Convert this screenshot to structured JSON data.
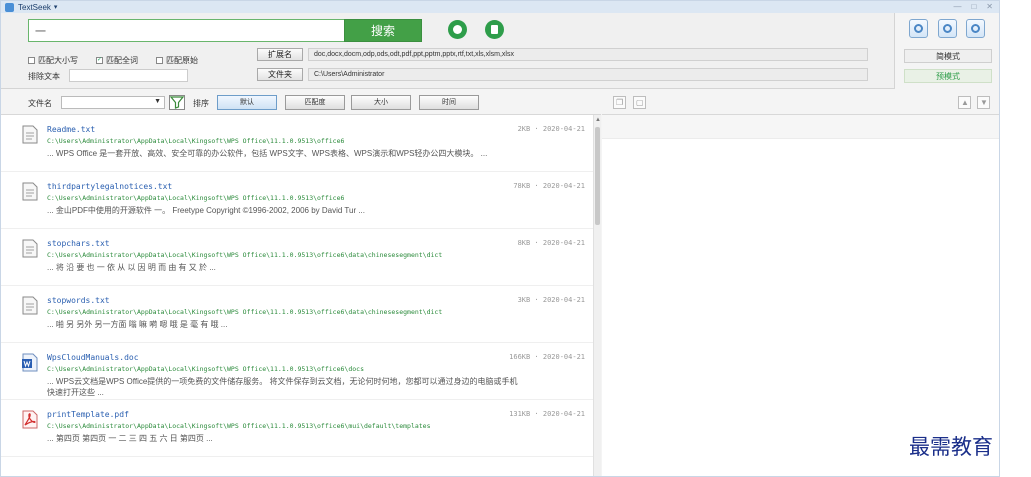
{
  "app": {
    "title": "TextSeek"
  },
  "search": {
    "query": "一",
    "button_label": "搜索"
  },
  "options": {
    "match_case": {
      "label": "匹配大小写",
      "checked": false
    },
    "match_whole": {
      "label": "匹配全词",
      "checked": true
    },
    "match_regex": {
      "label": "匹配原始",
      "checked": false
    },
    "exclude_label": "排除文本",
    "exclude_value": ""
  },
  "extension_row": {
    "button_label": "扩展名",
    "value": "doc,docx,docm,odp,ods,odt,pdf,ppt,pptm,pptx,rtf,txt,xls,xlsm,xlsx"
  },
  "folder_row": {
    "button_label": "文件夹",
    "value": "C:\\Users\\Administrator"
  },
  "side": {
    "mode_simple": "简模式",
    "mode_detail": "预模式"
  },
  "filter": {
    "filename_label": "文件名",
    "sort_label": "排序",
    "sort_buttons": [
      "默认",
      "匹配度",
      "大小",
      "时间"
    ]
  },
  "results": [
    {
      "name": "Readme.txt",
      "meta": "2KB · 2020-04-21",
      "path": "C:\\Users\\Administrator\\AppData\\Local\\Kingsoft\\WPS Office\\11.1.0.9513\\office6",
      "snippet": "... WPS Office 是一套开放、高效、安全可靠的办公软件，包括 WPS文字、WPS表格、WPS演示和WPS轻办公四大模块。 ...",
      "snippet2": "",
      "icon": "text-file-icon"
    },
    {
      "name": "thirdpartylegalnotices.txt",
      "meta": "78KB · 2020-04-21",
      "path": "C:\\Users\\Administrator\\AppData\\Local\\Kingsoft\\WPS Office\\11.1.0.9513\\office6",
      "snippet": "... 金山PDF中使用的开源软件 一。 Freetype Copyright ©1996-2002, 2006 by David Tur ...",
      "snippet2": "",
      "icon": "text-file-icon"
    },
    {
      "name": "stopchars.txt",
      "meta": "8KB · 2020-04-21",
      "path": "C:\\Users\\Administrator\\AppData\\Local\\Kingsoft\\WPS Office\\11.1.0.9513\\office6\\data\\chinesesegment\\dict",
      "snippet": "... 将 沿 要 也 一 依 从 以 因 明 而 由 有 又 於 ...",
      "snippet2": "",
      "icon": "text-file-icon"
    },
    {
      "name": "stopwords.txt",
      "meta": "3KB · 2020-04-21",
      "path": "C:\\Users\\Administrator\\AppData\\Local\\Kingsoft\\WPS Office\\11.1.0.9513\\office6\\data\\chinesesegment\\dict",
      "snippet": "... 啪 另 另外 另一方面 嗡 嘛 嗬 嗯 哦 是 毫 有 哦 ...",
      "snippet2": "",
      "icon": "text-file-icon"
    },
    {
      "name": "WpsCloudManuals.doc",
      "meta": "166KB · 2020-04-21",
      "path": "C:\\Users\\Administrator\\AppData\\Local\\Kingsoft\\WPS Office\\11.1.0.9513\\office6\\docs",
      "snippet": "... WPS云文档是WPS Office提供的一项免费的文件储存服务。 将文件保存到云文档，无论何时何地，您都可以通过身边的电脑或手机",
      "snippet2": "快速打开这些 ...",
      "icon": "word-file-icon"
    },
    {
      "name": "printTemplate.pdf",
      "meta": "131KB · 2020-04-21",
      "path": "C:\\Users\\Administrator\\AppData\\Local\\Kingsoft\\WPS Office\\11.1.0.9513\\office6\\mui\\default\\templates",
      "snippet": "... 第四页 第四页 一 二 三 四 五 六 日 第四页 ...",
      "snippet2": "",
      "icon": "pdf-file-icon"
    }
  ],
  "watermark": "最需教育",
  "colors": {
    "accent_green": "#43a047",
    "link_blue": "#2a5fb0",
    "path_green": "#2a8a3a"
  }
}
